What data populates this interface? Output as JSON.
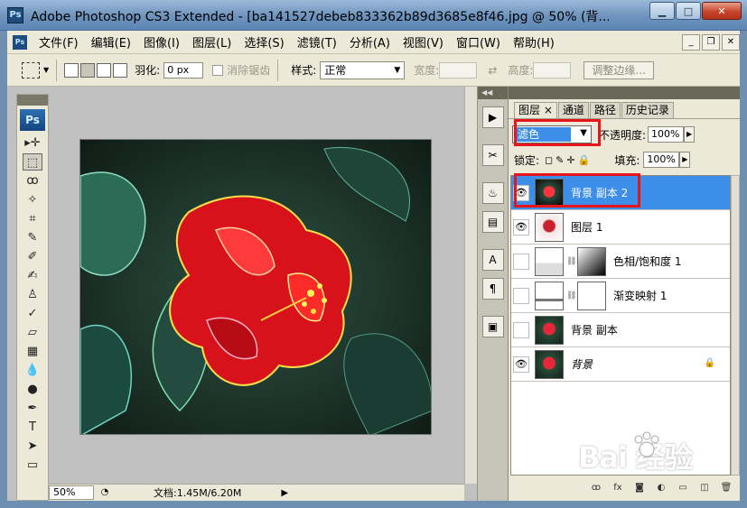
{
  "window": {
    "app_badge": "Ps",
    "title": "Adobe Photoshop CS3 Extended - [ba141527debeb833362b89d3685e8f46.jpg @ 50% (背...",
    "minimize": "▁",
    "maximize": "□",
    "close": "✕"
  },
  "menu": {
    "items": [
      "文件(F)",
      "编辑(E)",
      "图像(I)",
      "图层(L)",
      "选择(S)",
      "滤镜(T)",
      "分析(A)",
      "视图(V)",
      "窗口(W)",
      "帮助(H)"
    ],
    "doc_minimize": "_",
    "doc_restore": "❐",
    "doc_close": "✕"
  },
  "options": {
    "feather_label": "羽化:",
    "feather_value": "0 px",
    "antialias_label": "消除锯齿",
    "style_label": "样式:",
    "style_value": "正常",
    "width_label": "宽度:",
    "height_label": "高度:",
    "refine_edge": "调整边缘..."
  },
  "toolbox": {
    "logo": "Ps",
    "tools": [
      "▸✛",
      "⬚",
      "ꝏ",
      "✧",
      "⌗",
      "✎",
      "✐",
      "✍",
      "♙",
      "✓",
      "▱",
      "▦",
      "💧",
      "●",
      "✒",
      "T",
      "➤",
      "▭"
    ]
  },
  "status": {
    "zoom": "50%",
    "doc_info": "文档:1.45M/6.20M",
    "arrow": "▶"
  },
  "dock": {
    "buttons": [
      "▶",
      "✂",
      "♨",
      "▤",
      "A",
      "¶",
      "▣"
    ]
  },
  "layers_panel": {
    "tabs": [
      "图层 ×",
      "通道",
      "路径",
      "历史记录"
    ],
    "blend_mode": "滤色",
    "opacity_label": "不透明度:",
    "opacity_value": "100%",
    "lock_label": "锁定:",
    "lock_icons": "◻✎✛🔒",
    "fill_label": "填充:",
    "fill_value": "100%",
    "layers": [
      {
        "name": "背景 副本 2",
        "visible": true,
        "selected": true
      },
      {
        "name": "图层 1",
        "visible": true,
        "selected": false
      },
      {
        "name": "色相/饱和度 1",
        "visible": false,
        "selected": false
      },
      {
        "name": "渐变映射 1",
        "visible": false,
        "selected": false
      },
      {
        "name": "背景 副本",
        "visible": false,
        "selected": false
      },
      {
        "name": "背景",
        "visible": true,
        "selected": false
      }
    ],
    "footer_icons": [
      "ꝏ",
      "fx",
      "◙",
      "◐",
      "▭",
      "◫",
      "🗑"
    ]
  },
  "watermark": {
    "text": "Bai  经验"
  },
  "colors": {
    "highlight": "#3d8ee8",
    "annotation_red": "#e8141b"
  }
}
